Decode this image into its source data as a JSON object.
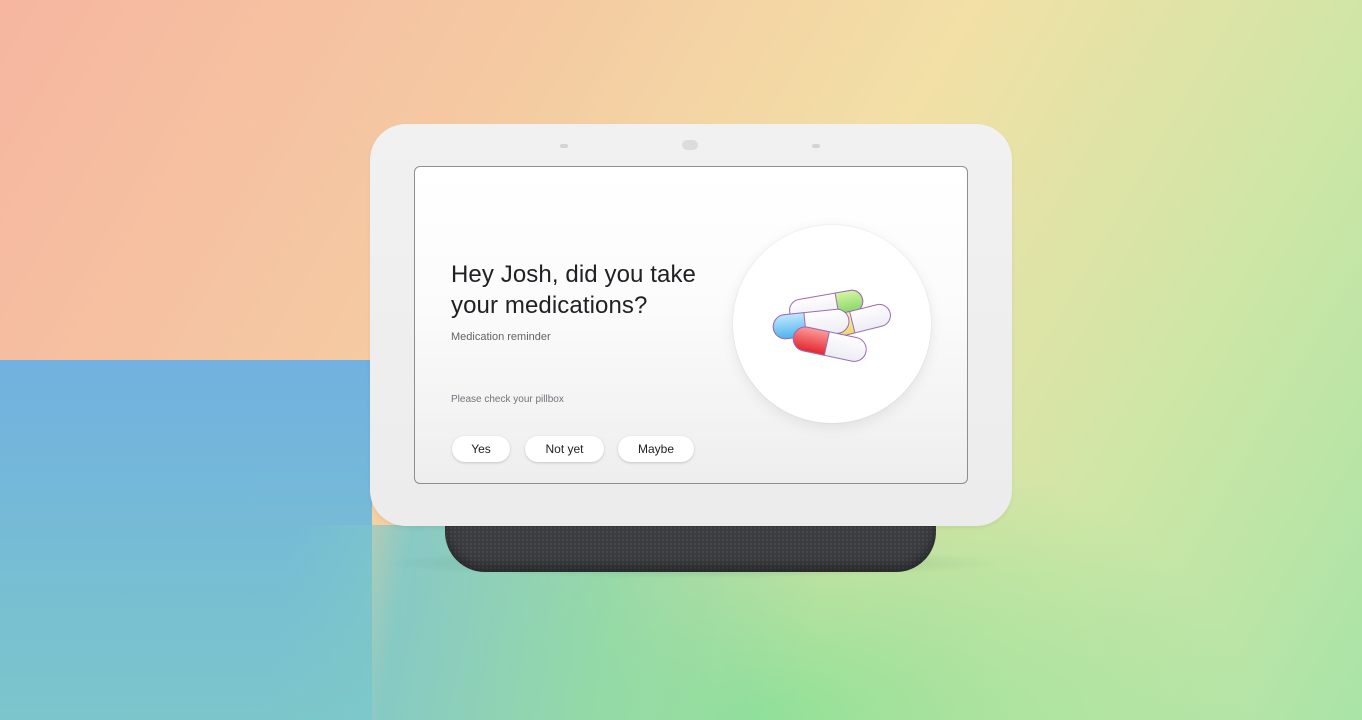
{
  "assistant_card": {
    "headline": "Hey Josh, did you take your medications?",
    "subtitle": "Medication reminder",
    "note": "Please check your pillbox",
    "buttons": {
      "yes": "Yes",
      "not_yet": "Not yet",
      "maybe": "Maybe"
    },
    "illustration": "pills-icon"
  },
  "colors": {
    "screen_bg": "#ffffff",
    "bezel": "#efefef",
    "speaker": "#3a3c3f",
    "text_primary": "#202124",
    "text_secondary": "#5f6368"
  }
}
